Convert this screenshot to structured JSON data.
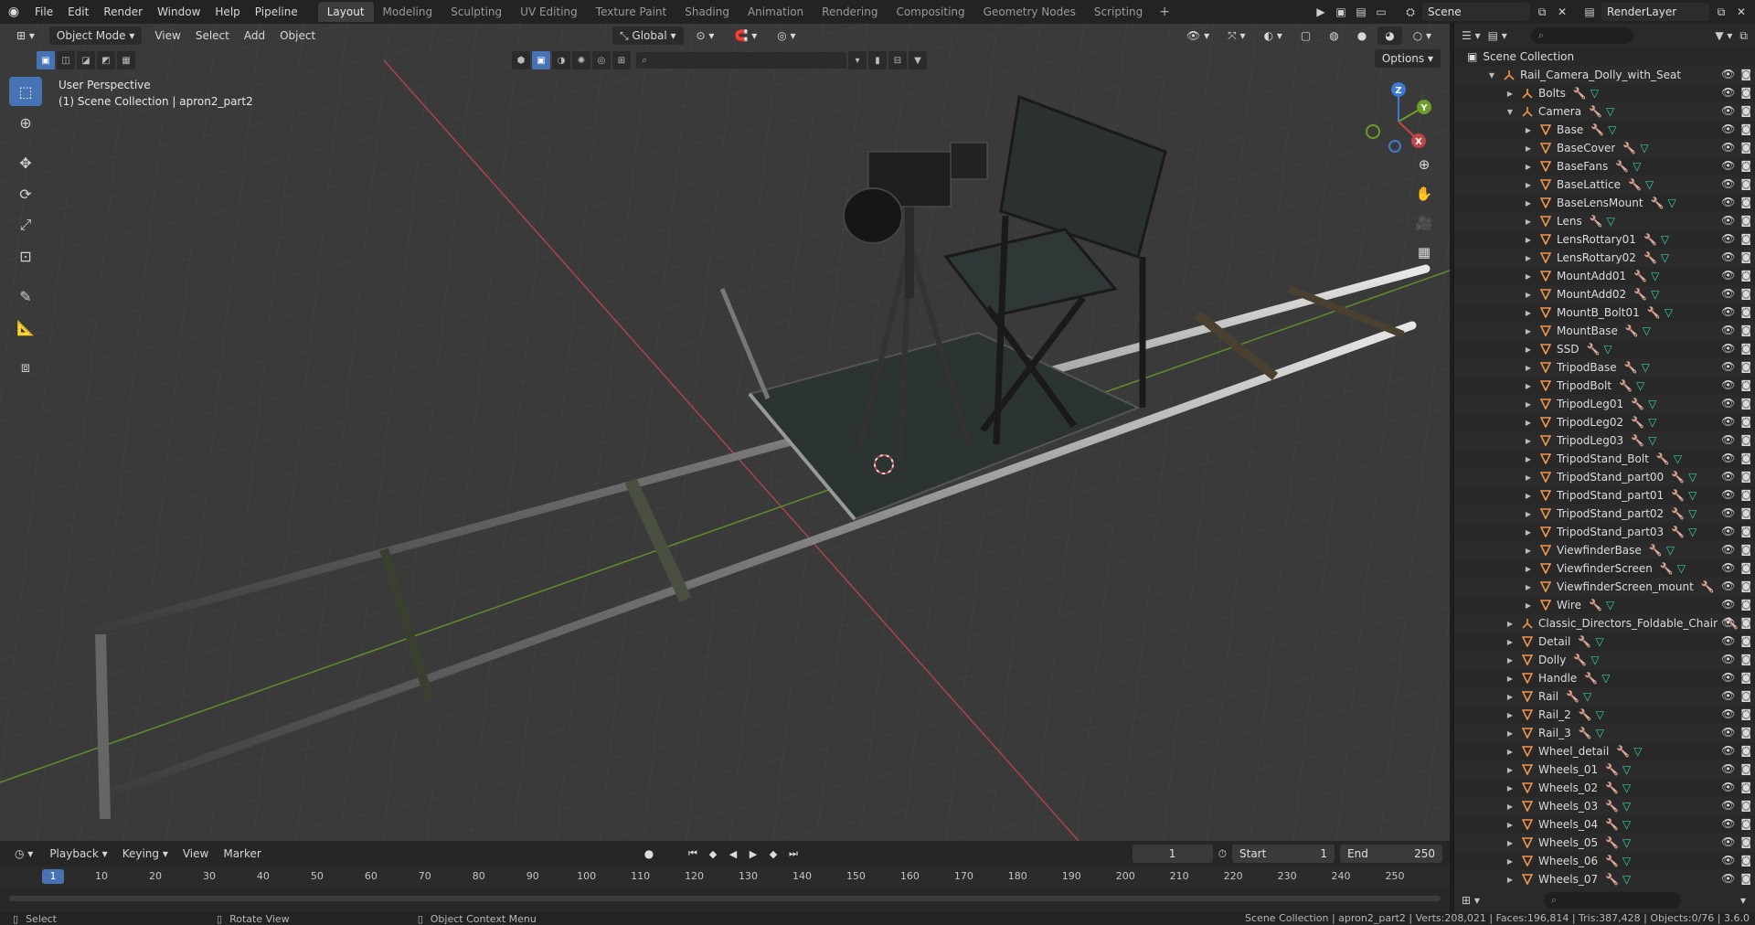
{
  "menubar": {
    "items": [
      "File",
      "Edit",
      "Render",
      "Window",
      "Help",
      "Pipeline"
    ],
    "workspaces": [
      "Layout",
      "Modeling",
      "Sculpting",
      "UV Editing",
      "Texture Paint",
      "Shading",
      "Animation",
      "Rendering",
      "Compositing",
      "Geometry Nodes",
      "Scripting"
    ],
    "active_workspace": "Layout",
    "add_tab": "+",
    "scene": "Scene",
    "render_layer": "RenderLayer"
  },
  "viewport": {
    "mode": "Object Mode",
    "menus": [
      "View",
      "Select",
      "Add",
      "Object"
    ],
    "orientation": "Global",
    "options_label": "Options",
    "info_line1": "User Perspective",
    "info_line2": "(1) Scene Collection | apron2_part2",
    "gizmo": {
      "x": "X",
      "y": "Y",
      "z": "Z"
    }
  },
  "timeline": {
    "menus": [
      "Playback",
      "Keying",
      "View",
      "Marker"
    ],
    "current_frame": "1",
    "start_label": "Start",
    "start_value": "1",
    "end_label": "End",
    "end_value": "250",
    "ticks": [
      "1",
      "10",
      "20",
      "30",
      "40",
      "50",
      "60",
      "70",
      "80",
      "90",
      "100",
      "110",
      "120",
      "130",
      "140",
      "150",
      "160",
      "170",
      "180",
      "190",
      "200",
      "210",
      "220",
      "230",
      "240",
      "250"
    ]
  },
  "statusbar": {
    "select": "Select",
    "rotate": "Rotate View",
    "context": "Object Context Menu",
    "stats": "Scene Collection | apron2_part2 | Verts:208,021 | Faces:196,814 | Tris:387,428 | Objects:0/76 | 3.6.0"
  },
  "outliner": {
    "root": "Scene Collection",
    "rows": [
      {
        "label": "Rail_Camera_Dolly_with_Seat_and_Camera",
        "depth": 1,
        "type": "collection",
        "expanded": true
      },
      {
        "label": "Bolts",
        "depth": 2,
        "type": "empty",
        "expanded": false
      },
      {
        "label": "Camera",
        "depth": 2,
        "type": "empty",
        "expanded": true
      },
      {
        "label": "Base",
        "depth": 3,
        "type": "mesh"
      },
      {
        "label": "BaseCover",
        "depth": 3,
        "type": "mesh"
      },
      {
        "label": "BaseFans",
        "depth": 3,
        "type": "mesh"
      },
      {
        "label": "BaseLattice",
        "depth": 3,
        "type": "mesh"
      },
      {
        "label": "BaseLensMount",
        "depth": 3,
        "type": "mesh"
      },
      {
        "label": "Lens",
        "depth": 3,
        "type": "mesh"
      },
      {
        "label": "LensRottary01",
        "depth": 3,
        "type": "mesh"
      },
      {
        "label": "LensRottary02",
        "depth": 3,
        "type": "mesh"
      },
      {
        "label": "MountAdd01",
        "depth": 3,
        "type": "mesh"
      },
      {
        "label": "MountAdd02",
        "depth": 3,
        "type": "mesh"
      },
      {
        "label": "MountB_Bolt01",
        "depth": 3,
        "type": "mesh"
      },
      {
        "label": "MountBase",
        "depth": 3,
        "type": "mesh"
      },
      {
        "label": "SSD",
        "depth": 3,
        "type": "mesh"
      },
      {
        "label": "TripodBase",
        "depth": 3,
        "type": "mesh"
      },
      {
        "label": "TripodBolt",
        "depth": 3,
        "type": "mesh"
      },
      {
        "label": "TripodLeg01",
        "depth": 3,
        "type": "mesh"
      },
      {
        "label": "TripodLeg02",
        "depth": 3,
        "type": "mesh"
      },
      {
        "label": "TripodLeg03",
        "depth": 3,
        "type": "mesh"
      },
      {
        "label": "TripodStand_Bolt",
        "depth": 3,
        "type": "mesh"
      },
      {
        "label": "TripodStand_part00",
        "depth": 3,
        "type": "mesh"
      },
      {
        "label": "TripodStand_part01",
        "depth": 3,
        "type": "mesh"
      },
      {
        "label": "TripodStand_part02",
        "depth": 3,
        "type": "mesh"
      },
      {
        "label": "TripodStand_part03",
        "depth": 3,
        "type": "mesh"
      },
      {
        "label": "ViewfinderBase",
        "depth": 3,
        "type": "mesh"
      },
      {
        "label": "ViewfinderScreen",
        "depth": 3,
        "type": "mesh"
      },
      {
        "label": "ViewfinderScreen_mount",
        "depth": 3,
        "type": "mesh"
      },
      {
        "label": "Wire",
        "depth": 3,
        "type": "mesh"
      },
      {
        "label": "Classic_Directors_Foldable_Chair",
        "depth": 2,
        "type": "empty",
        "expanded": false
      },
      {
        "label": "Detail",
        "depth": 2,
        "type": "mesh"
      },
      {
        "label": "Dolly",
        "depth": 2,
        "type": "mesh"
      },
      {
        "label": "Handle",
        "depth": 2,
        "type": "mesh"
      },
      {
        "label": "Rail",
        "depth": 2,
        "type": "mesh"
      },
      {
        "label": "Rail_2",
        "depth": 2,
        "type": "mesh"
      },
      {
        "label": "Rail_3",
        "depth": 2,
        "type": "mesh"
      },
      {
        "label": "Wheel_detail",
        "depth": 2,
        "type": "mesh"
      },
      {
        "label": "Wheels_01",
        "depth": 2,
        "type": "mesh"
      },
      {
        "label": "Wheels_02",
        "depth": 2,
        "type": "mesh"
      },
      {
        "label": "Wheels_03",
        "depth": 2,
        "type": "mesh"
      },
      {
        "label": "Wheels_04",
        "depth": 2,
        "type": "mesh"
      },
      {
        "label": "Wheels_05",
        "depth": 2,
        "type": "mesh"
      },
      {
        "label": "Wheels_06",
        "depth": 2,
        "type": "mesh"
      },
      {
        "label": "Wheels_07",
        "depth": 2,
        "type": "mesh"
      }
    ]
  },
  "colors": {
    "accent": "#4772b3",
    "x_axis": "#c0464a",
    "y_axis": "#6b9c2c",
    "z_axis": "#3c7bd6",
    "mesh_icon": "#f0964b",
    "modifier": "#6aa7e8",
    "mesh_data": "#39d0a7"
  }
}
